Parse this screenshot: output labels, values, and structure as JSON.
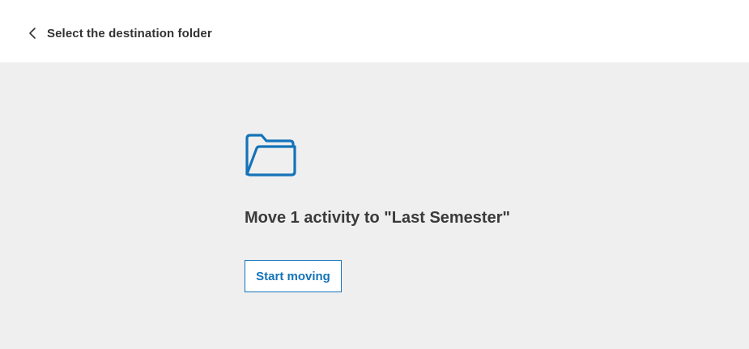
{
  "header": {
    "back_label": "Select the destination folder",
    "back_icon": "chevron-left-icon"
  },
  "main": {
    "icon": "folder-open-icon",
    "title": "Move 1 activity to \"Last Semester\"",
    "start_button_label": "Start moving"
  },
  "colors": {
    "accent": "#1473b9",
    "background": "#efefef",
    "header_background": "#ffffff",
    "text": "#333333"
  }
}
